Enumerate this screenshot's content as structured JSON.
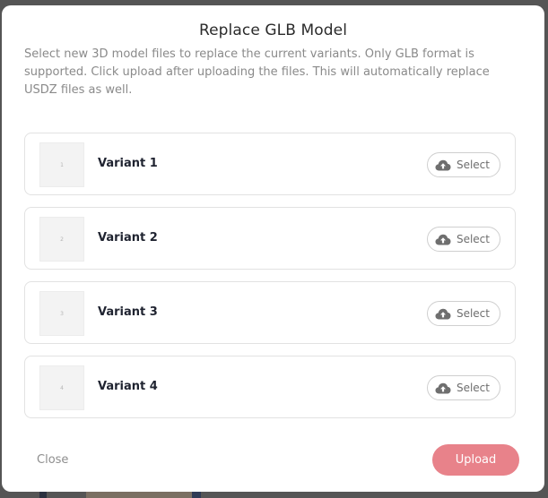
{
  "modal": {
    "title": "Replace GLB Model",
    "description": "Select new 3D model files to replace the current variants. Only GLB format is supported. Click upload after uploading the files. This will automatically replace USDZ files as well."
  },
  "variants": [
    {
      "thumb": "1",
      "name": "Variant 1",
      "select_label": "Select",
      "icon": "cloud-upload-icon"
    },
    {
      "thumb": "2",
      "name": "Variant 2",
      "select_label": "Select",
      "icon": "cloud-upload-icon"
    },
    {
      "thumb": "3",
      "name": "Variant 3",
      "select_label": "Select",
      "icon": "cloud-upload-icon"
    },
    {
      "thumb": "4",
      "name": "Variant 4",
      "select_label": "Select",
      "icon": "cloud-upload-icon"
    }
  ],
  "footer": {
    "close_label": "Close",
    "upload_label": "Upload"
  },
  "colors": {
    "accent": "#e8828a",
    "overlay": "#5b5b5b"
  }
}
